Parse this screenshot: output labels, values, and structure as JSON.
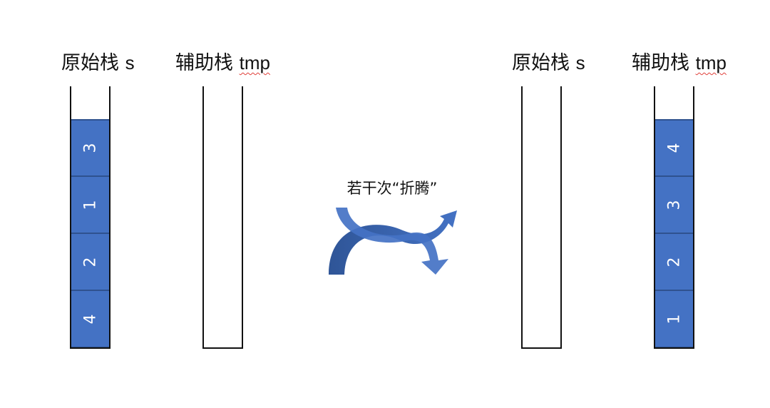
{
  "left_group": {
    "original_stack": {
      "name": "原始栈",
      "var": "s",
      "values": [
        "3",
        "1",
        "2",
        "4"
      ]
    },
    "temp_stack": {
      "name": "辅助栈",
      "var": "tmp",
      "values": []
    }
  },
  "caption": "若干次“折腾”",
  "right_group": {
    "original_stack": {
      "name": "原始栈",
      "var": "s",
      "values": []
    },
    "temp_stack": {
      "name": "辅助栈",
      "var": "tmp",
      "values": [
        "4",
        "3",
        "2",
        "1"
      ]
    }
  },
  "colors": {
    "cell_fill": "#4472c4",
    "cell_border": "#2f528f",
    "arrow": "#4472c4",
    "arrow_dark": "#2f5597"
  },
  "icons": {
    "transition": "curved-swap-arrows-icon"
  }
}
